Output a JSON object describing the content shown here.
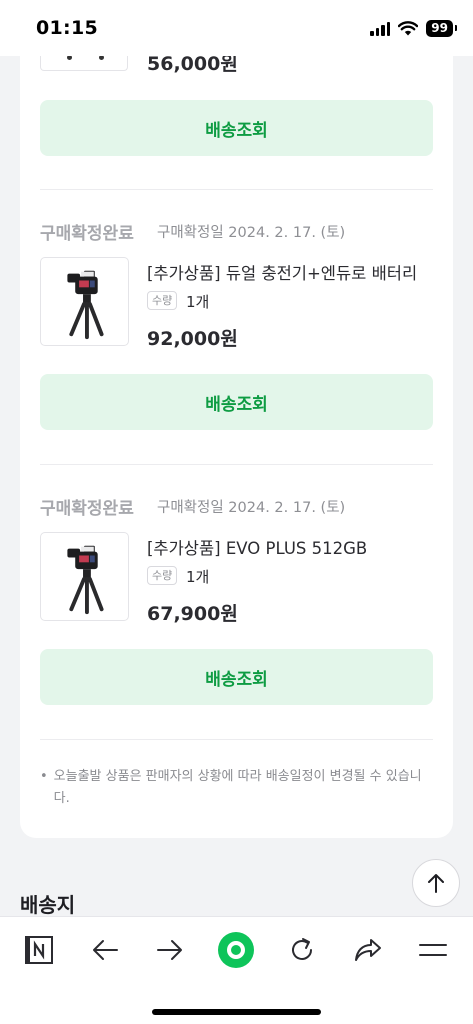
{
  "status_bar": {
    "time": "01:15",
    "battery": "99"
  },
  "previous_item": {
    "price": "56,000원",
    "track_button": "배송조회"
  },
  "orders": [
    {
      "status": "구매확정완료",
      "confirm_date": "구매확정일 2024. 2. 17. (토)",
      "product_name": "[추가상품] 듀얼 충전기+엔듀로 배터리",
      "qty_label": "수량",
      "qty_value": "1개",
      "price": "92,000원",
      "track_button": "배송조회"
    },
    {
      "status": "구매확정완료",
      "confirm_date": "구매확정일 2024. 2. 17. (토)",
      "product_name": "[추가상품] EVO PLUS 512GB",
      "qty_label": "수량",
      "qty_value": "1개",
      "price": "67,900원",
      "track_button": "배송조회"
    }
  ],
  "notice": {
    "bullet": "•",
    "text": "오늘출발 상품은 판매자의 상황에 따라 배송일정이 변경될 수 있습니다."
  },
  "shipping_section": {
    "title": "배송지"
  },
  "toolbar": {
    "items": [
      "naver-home-icon",
      "back-arrow-icon",
      "forward-arrow-icon",
      "green-dot-icon",
      "refresh-icon",
      "share-icon",
      "menu-icon"
    ]
  },
  "colors": {
    "accent_green": "#0e9c43",
    "button_bg": "#e3f6ea",
    "page_bg": "#f2f3f5"
  }
}
